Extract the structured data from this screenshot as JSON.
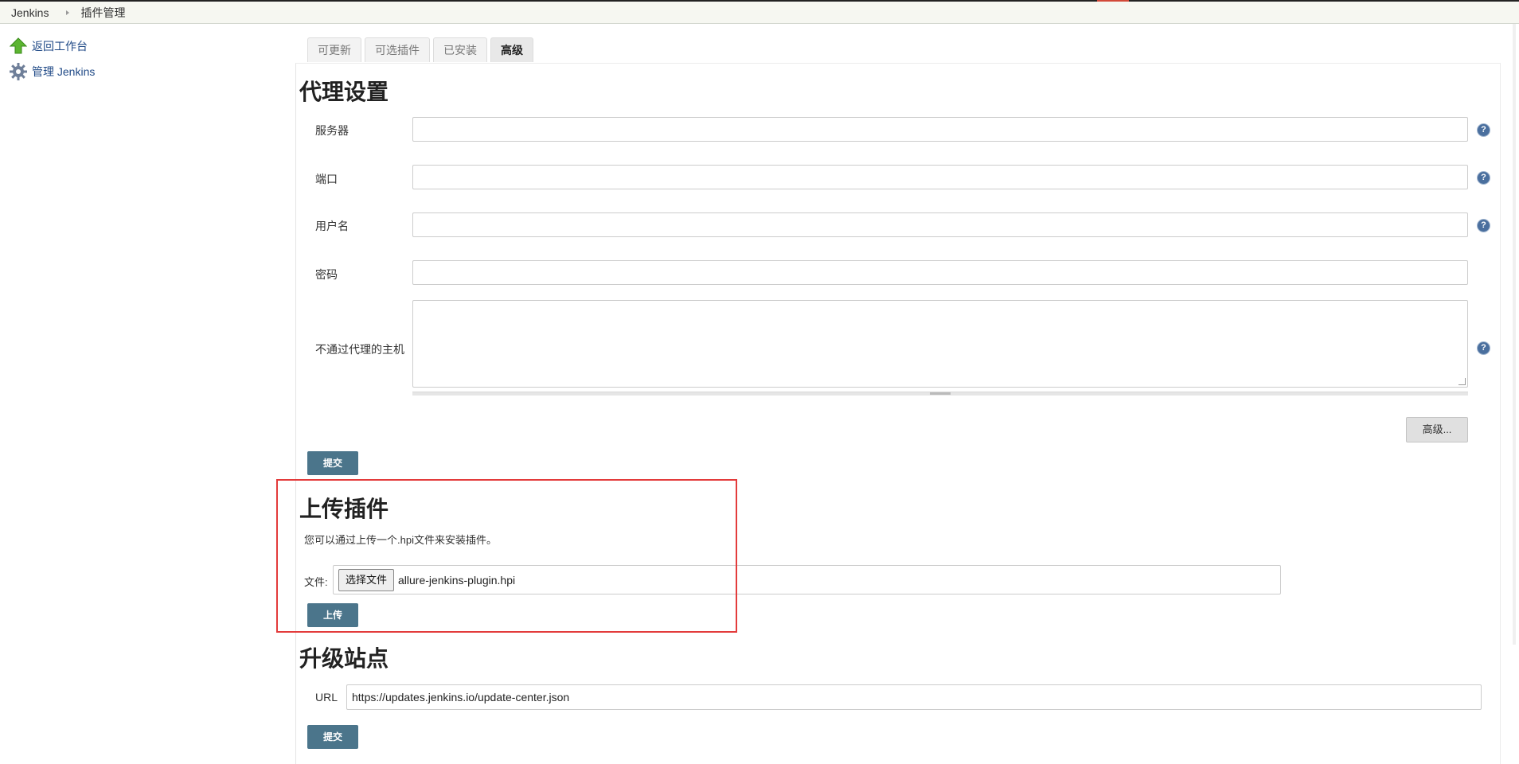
{
  "breadcrumb": {
    "home": "Jenkins",
    "current": "插件管理"
  },
  "sidebar": {
    "items": [
      {
        "label": "返回工作台",
        "icon": "up-arrow-icon"
      },
      {
        "label": "管理 Jenkins",
        "icon": "gear-icon"
      }
    ]
  },
  "tabs": [
    {
      "label": "可更新",
      "active": false
    },
    {
      "label": "可选插件",
      "active": false
    },
    {
      "label": "已安装",
      "active": false
    },
    {
      "label": "高级",
      "active": true
    }
  ],
  "proxy": {
    "title": "代理设置",
    "server_label": "服务器",
    "port_label": "端口",
    "username_label": "用户名",
    "password_label": "密码",
    "no_proxy_label": "不通过代理的主机",
    "advanced_button": "高级...",
    "submit_button": "提交",
    "help_glyph": "?"
  },
  "upload": {
    "title": "上传插件",
    "description": "您可以通过上传一个.hpi文件来安装插件。",
    "file_label": "文件:",
    "choose_button": "选择文件",
    "file_name": "allure-jenkins-plugin.hpi",
    "upload_button": "上传"
  },
  "update_site": {
    "title": "升级站点",
    "url_label": "URL",
    "url_value": "https://updates.jenkins.io/update-center.json",
    "submit_button": "提交"
  },
  "colors": {
    "primary_button": "#4b758b",
    "link": "#204a87",
    "highlight": "#e33b3b",
    "help_icon": "#4a6f9e"
  }
}
